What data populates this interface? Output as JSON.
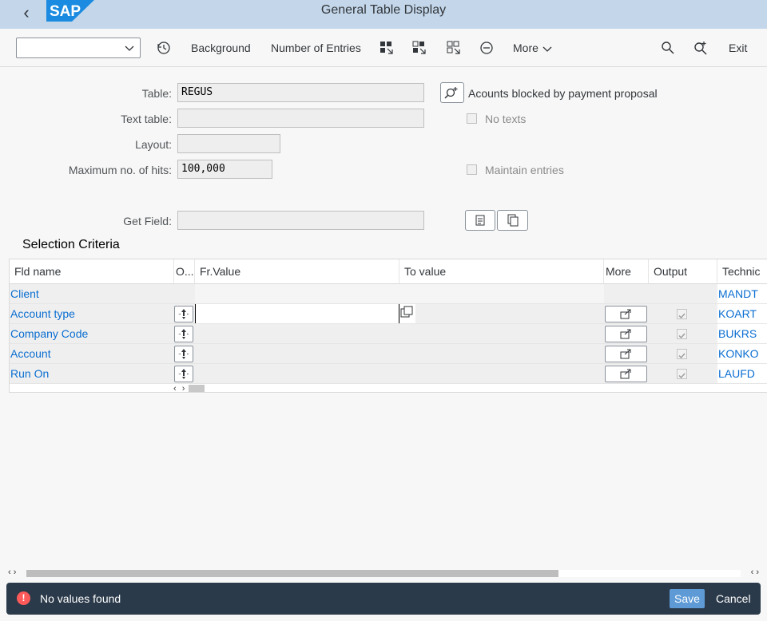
{
  "titlebar": {
    "title": "General Table Display",
    "logo_text": "SAP"
  },
  "toolbar": {
    "combo_value": "",
    "background_label": "Background",
    "entries_label": "Number of Entries",
    "more_label": "More",
    "exit_label": "Exit"
  },
  "form": {
    "table_label": "Table:",
    "table_value": "REGUS",
    "table_desc": "Acounts blocked by payment proposal",
    "text_table_label": "Text table:",
    "text_table_value": "",
    "no_texts_label": "No texts",
    "layout_label": "Layout:",
    "layout_value": "",
    "max_hits_label": "Maximum no. of hits:",
    "max_hits_value": "100,000",
    "maintain_label": "Maintain entries",
    "get_field_label": "Get Field:",
    "get_field_value": ""
  },
  "selection": {
    "title": "Selection Criteria",
    "columns": [
      "Fld name",
      "O...",
      "Fr.Value",
      "To value",
      "More",
      "Output",
      "Technic"
    ],
    "rows": [
      {
        "fld": "Client",
        "tech": "MANDT",
        "has_controls": false
      },
      {
        "fld": "Account type",
        "tech": "KOART",
        "has_controls": true
      },
      {
        "fld": "Company Code",
        "tech": "BUKRS",
        "has_controls": true
      },
      {
        "fld": "Account",
        "tech": "KONKO",
        "has_controls": true
      },
      {
        "fld": "Run On",
        "tech": "LAUFD",
        "has_controls": true
      }
    ]
  },
  "footer": {
    "message": "No values found",
    "save_label": "Save",
    "cancel_label": "Cancel"
  },
  "colors": {
    "titlebar": "#c3d6ea",
    "link": "#0a6ed1",
    "footer": "#2b3a4a",
    "save": "#5d9ad6",
    "error": "#ff5a5a"
  }
}
